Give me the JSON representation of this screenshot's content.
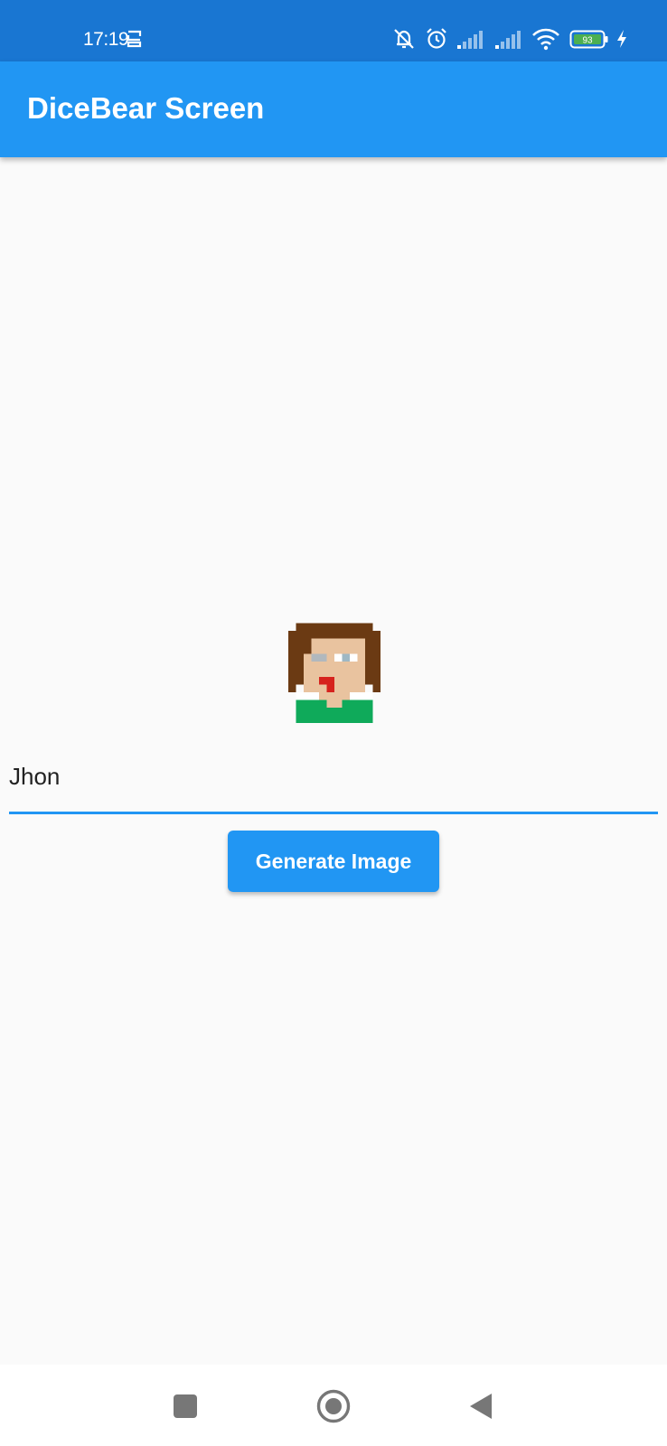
{
  "status_bar": {
    "time": "17:19",
    "battery_level": "93",
    "icons": [
      "sync-icon",
      "muted-bell-icon",
      "alarm-icon",
      "signal-icon",
      "signal-icon",
      "wifi-icon",
      "battery-icon",
      "charging-icon"
    ]
  },
  "app_bar": {
    "title": "DiceBear Screen"
  },
  "avatar": {
    "icon": "pixel-art-avatar"
  },
  "name_field": {
    "value": "Jhon"
  },
  "generate_button": {
    "label": "Generate Image"
  },
  "nav_bar": {
    "icons": [
      "recents-icon",
      "home-icon",
      "back-icon"
    ]
  },
  "colors": {
    "status_bar": "#1976d2",
    "app_bar": "#2196f3",
    "accent": "#2196f3",
    "background": "#fafafa",
    "nav_bar": "#ffffff"
  }
}
